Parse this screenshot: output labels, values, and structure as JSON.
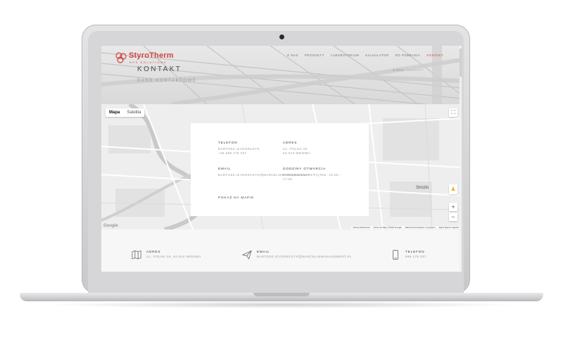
{
  "brand": {
    "name": "StyroTherm",
    "tagline": "EPS SOLUTIONS",
    "accent_color": "#d0443c"
  },
  "nav": {
    "items": [
      {
        "label": "O NAS"
      },
      {
        "label": "PRODUKTY"
      },
      {
        "label": "LABORATORIUM"
      },
      {
        "label": "KALKULATOR"
      },
      {
        "label": "DO POBRANIA"
      },
      {
        "label": "KONTAKT",
        "active": true
      }
    ]
  },
  "hero": {
    "title": "KONTAKT",
    "subtitle": "DANE KONTAKTOWE",
    "breadcrumb": {
      "home": "O NAS",
      "separator": "/",
      "current": "KONTAKT"
    }
  },
  "map": {
    "view_options": [
      "Mapa",
      "Satelita"
    ],
    "selected_view": "Mapa",
    "town_label": "Stróżki",
    "google_label": "Google",
    "attribution": [
      "Skróty klawiszowe",
      "Dane do Mapy ©2022 Google",
      "Warunki korzystania z programu",
      "Zgłoś błąd w mapach"
    ],
    "icons": {
      "fullscreen": "fullscreen-icon",
      "pegman": "pegman-icon",
      "zoom_in": "plus-icon",
      "zoom_out": "minus-icon"
    }
  },
  "card": {
    "phone": {
      "heading": "TELEFON",
      "name": "BARTOSZ IZYDORCZYK",
      "number": "+48 698 175 037"
    },
    "address": {
      "heading": "ADRES",
      "street": "UL. POLNA 26",
      "city": "64-510 WRONKI"
    },
    "email": {
      "heading": "EMAIL",
      "value": "BARTOSZ.IZYDORCZYK@MARCELINMANAGEMENT.PL"
    },
    "hours": {
      "heading": "GODZINY OTWARCIA",
      "value_line1": "PONIEDZIAŁEK - PIĄTEK: 10:00 -",
      "value_line2": "17:00"
    },
    "show_map_label": "POKAŻ NA MAPIE"
  },
  "footer": {
    "address": {
      "heading": "ADRES",
      "value": "UL. POLNA 26, 64-510 WRONKI",
      "icon": "map-icon"
    },
    "email": {
      "heading": "EMAIL",
      "value": "BARTOSZ.IZYDORCZYK@MARCELINMANAGEMENT.PL",
      "icon": "paper-plane-icon"
    },
    "phone": {
      "heading": "TELEFON",
      "value": "698 175 037",
      "icon": "phone-icon"
    }
  }
}
